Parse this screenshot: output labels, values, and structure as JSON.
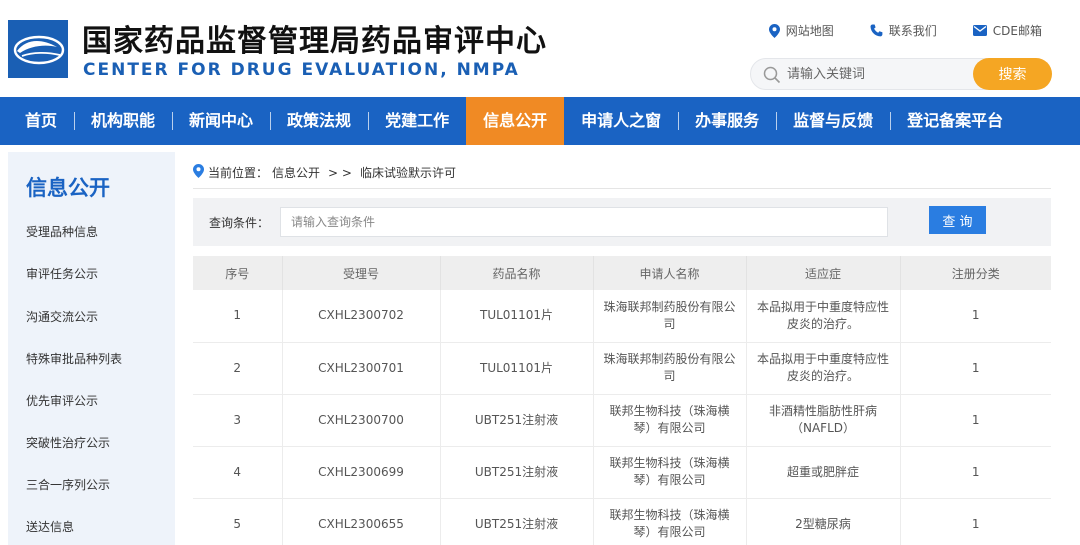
{
  "header": {
    "title_cn": "国家药品监督管理局药品审评中心",
    "title_en": "CENTER FOR DRUG EVALUATION, NMPA",
    "logo_icon": "cde-logo-icon",
    "brand_color": "#1a63c3",
    "accent_color": "#f08a24"
  },
  "top_links": [
    {
      "label": "网站地图",
      "icon": "location-pin-icon"
    },
    {
      "label": "联系我们",
      "icon": "phone-icon"
    },
    {
      "label": "CDE邮箱",
      "icon": "mail-icon"
    }
  ],
  "search": {
    "placeholder": "请输入关键词",
    "button_label": "搜索"
  },
  "nav": {
    "items": [
      "首页",
      "机构职能",
      "新闻中心",
      "政策法规",
      "党建工作",
      "信息公开",
      "申请人之窗",
      "办事服务",
      "监督与反馈",
      "登记备案平台"
    ],
    "active": "信息公开"
  },
  "sidebar": {
    "title": "信息公开",
    "items": [
      "受理品种信息",
      "审评任务公示",
      "沟通交流公示",
      "特殊审批品种列表",
      "优先审评公示",
      "突破性治疗公示",
      "三合一序列公示",
      "送达信息"
    ]
  },
  "breadcrumb": {
    "prefix": "当前位置：",
    "section": "信息公开",
    "separator": "> >",
    "current": "临床试验默示许可"
  },
  "query": {
    "label": "查询条件：",
    "placeholder": "请输入查询条件",
    "button_label": "查 询"
  },
  "table": {
    "headers": [
      "序号",
      "受理号",
      "药品名称",
      "申请人名称",
      "适应症",
      "注册分类"
    ],
    "rows": [
      [
        "1",
        "CXHL2300702",
        "TUL01101片",
        "珠海联邦制药股份有限公司",
        "本品拟用于中重度特应性皮炎的治疗。",
        "1"
      ],
      [
        "2",
        "CXHL2300701",
        "TUL01101片",
        "珠海联邦制药股份有限公司",
        "本品拟用于中重度特应性皮炎的治疗。",
        "1"
      ],
      [
        "3",
        "CXHL2300700",
        "UBT251注射液",
        "联邦生物科技（珠海横琴）有限公司",
        "非酒精性脂肪性肝病（NAFLD）",
        "1"
      ],
      [
        "4",
        "CXHL2300699",
        "UBT251注射液",
        "联邦生物科技（珠海横琴）有限公司",
        "超重或肥胖症",
        "1"
      ],
      [
        "5",
        "CXHL2300655",
        "UBT251注射液",
        "联邦生物科技（珠海横琴）有限公司",
        "2型糖尿病",
        "1"
      ]
    ]
  }
}
